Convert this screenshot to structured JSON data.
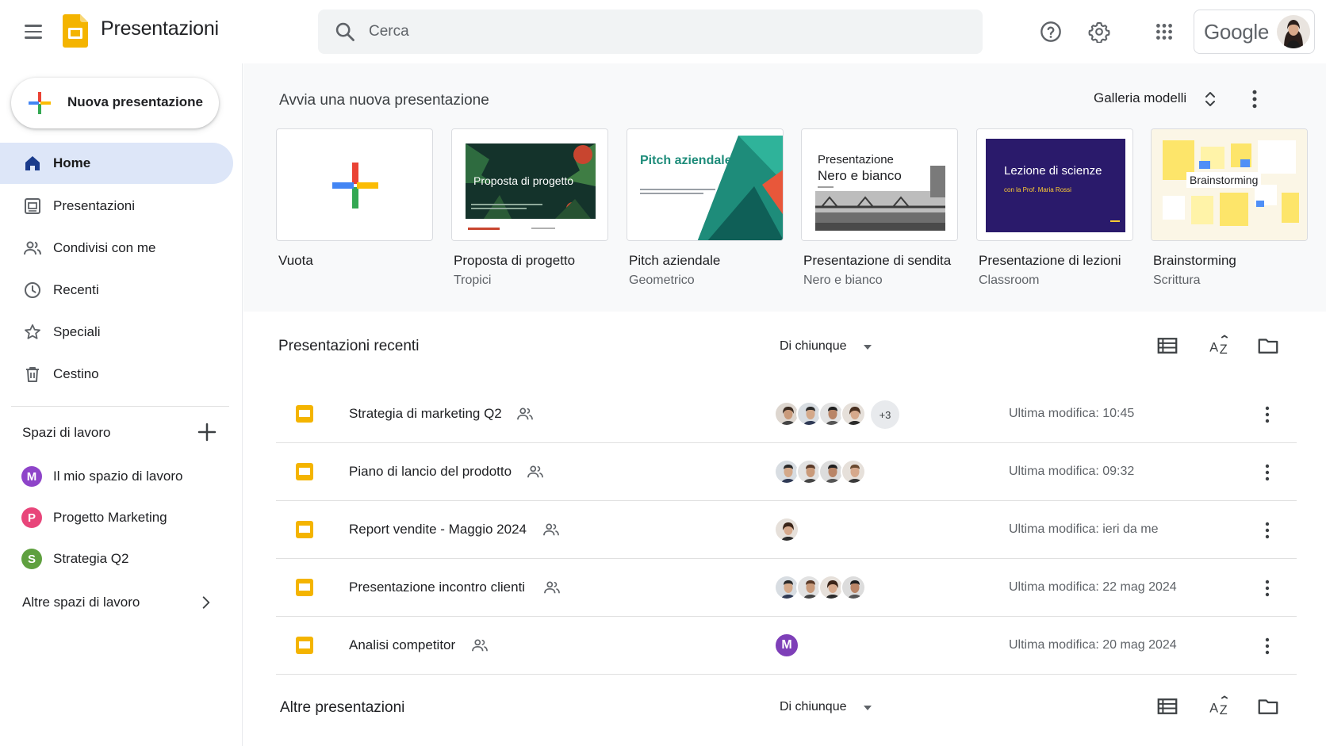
{
  "header": {
    "app_title": "Presentazioni",
    "search_placeholder": "Cerca",
    "google_label": "Google"
  },
  "sidebar": {
    "new_button": "Nuova presentazione",
    "items": [
      {
        "label": "Home",
        "icon": "home-icon",
        "active": true
      },
      {
        "label": "Presentazioni",
        "icon": "slides-icon"
      },
      {
        "label": "Condivisi con me",
        "icon": "people-icon"
      },
      {
        "label": "Recenti",
        "icon": "clock-icon"
      },
      {
        "label": "Speciali",
        "icon": "star-icon"
      },
      {
        "label": "Cestino",
        "icon": "trash-icon"
      }
    ],
    "workspaces_title": "Spazi di lavoro",
    "workspaces": [
      {
        "initial": "M",
        "label": "Il mio spazio di lavoro",
        "color": "#8e44c9"
      },
      {
        "initial": "P",
        "label": "Progetto Marketing",
        "color": "#e8457a"
      },
      {
        "initial": "S",
        "label": "Strategia Q2",
        "color": "#5fa03f"
      }
    ],
    "more_workspaces": "Altre spazi di lavoro"
  },
  "gallery": {
    "title": "Avvia una nuova presentazione",
    "models_label": "Galleria modelli",
    "templates": [
      {
        "name": "Vuota",
        "sub": ""
      },
      {
        "name": "Proposta di progetto",
        "sub": "Tropici",
        "thumb_text": "Proposta di progetto"
      },
      {
        "name": "Pitch aziendale",
        "sub": "Geometrico",
        "thumb_text": "Pitch aziendale"
      },
      {
        "name": "Presentazione di sendita",
        "sub": "Nero e bianco",
        "thumb_text_1": "Presentazione",
        "thumb_text_2": "Nero e bianco"
      },
      {
        "name": "Presentazione di lezioni",
        "sub": "Classroom",
        "thumb_text": "Lezione di scienze",
        "thumb_sub": "con la Prof. Maria Rossi"
      },
      {
        "name": "Brainstorming",
        "sub": "Scrittura",
        "thumb_text": "Brainstorming"
      }
    ]
  },
  "recent": {
    "title": "Presentazioni recenti",
    "owner_filter": "Di chiunque",
    "rows": [
      {
        "name": "Strategia di marketing Q2",
        "avatars": 4,
        "extra": "+3",
        "modified": "Ultima modifica: 10:45"
      },
      {
        "name": "Piano di lancio del prodotto",
        "avatars": 4,
        "extra": "",
        "modified": "Ultima modifica: 09:32"
      },
      {
        "name": "Report vendite - Maggio 2024",
        "avatars": 1,
        "extra": "",
        "modified": "Ultima modifica: ieri da me"
      },
      {
        "name": "Presentazione incontro clienti",
        "avatars": 4,
        "extra": "",
        "modified": "Ultima modifica: 22 mag 2024"
      },
      {
        "name": "Analisi competitor",
        "avatars": 0,
        "letter": "M",
        "extra": "",
        "modified": "Ultima modifica: 20 mag 2024"
      }
    ]
  },
  "other": {
    "title": "Altre presentazioni",
    "owner_filter": "Di chiunque"
  },
  "colors": {
    "slides_yellow": "#f4b400",
    "active_nav": "#dde6f8",
    "purple_avatar": "#7e3fb8"
  }
}
